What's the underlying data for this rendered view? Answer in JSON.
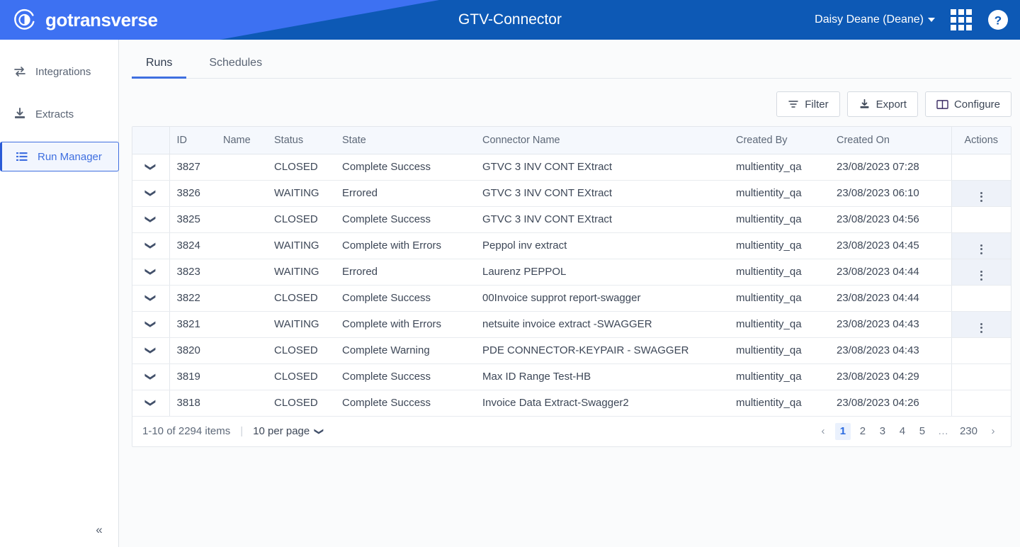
{
  "header": {
    "brand": "gotransverse",
    "logo_icon": "gotransverse-circle-logo",
    "title": "GTV-Connector",
    "user": "Daisy Deane (Deane)",
    "apps_icon": "grid-apps-icon",
    "help_icon": "help-question-icon",
    "colors": {
      "light_blue": "#3d71f2",
      "dark_blue": "#0d59b5"
    }
  },
  "sidebar": {
    "items": [
      {
        "label": "Integrations",
        "icon": "swap-arrows-icon",
        "active": false
      },
      {
        "label": "Extracts",
        "icon": "download-tray-icon",
        "active": false
      },
      {
        "label": "Run Manager",
        "icon": "list-bullets-icon",
        "active": true
      }
    ],
    "collapse_label": "«",
    "collapse_icon": "chevron-double-left-icon"
  },
  "tabs": [
    {
      "label": "Runs",
      "active": true
    },
    {
      "label": "Schedules",
      "active": false
    }
  ],
  "toolbar": {
    "filter_label": "Filter",
    "filter_icon": "filter-lines-icon",
    "export_label": "Export",
    "export_icon": "download-tray-icon",
    "configure_label": "Configure",
    "configure_icon": "columns-layout-icon"
  },
  "table": {
    "columns": [
      "",
      "ID",
      "Name",
      "Status",
      "State",
      "Connector Name",
      "Created By",
      "Created On",
      "Actions"
    ],
    "rows": [
      {
        "id": "3827",
        "name": "",
        "status": "CLOSED",
        "state": "Complete Success",
        "connector": "GTVC 3 INV CONT EXtract",
        "created_by": "multientity_qa",
        "created_on": "23/08/2023 07:28",
        "has_menu": false
      },
      {
        "id": "3826",
        "name": "",
        "status": "WAITING",
        "state": "Errored",
        "connector": "GTVC 3 INV CONT EXtract",
        "created_by": "multientity_qa",
        "created_on": "23/08/2023 06:10",
        "has_menu": true
      },
      {
        "id": "3825",
        "name": "",
        "status": "CLOSED",
        "state": "Complete Success",
        "connector": "GTVC 3 INV CONT EXtract",
        "created_by": "multientity_qa",
        "created_on": "23/08/2023 04:56",
        "has_menu": false
      },
      {
        "id": "3824",
        "name": "",
        "status": "WAITING",
        "state": "Complete with Errors",
        "connector": "Peppol inv extract",
        "created_by": "multientity_qa",
        "created_on": "23/08/2023 04:45",
        "has_menu": true
      },
      {
        "id": "3823",
        "name": "",
        "status": "WAITING",
        "state": "Errored",
        "connector": "Laurenz PEPPOL",
        "created_by": "multientity_qa",
        "created_on": "23/08/2023 04:44",
        "has_menu": true
      },
      {
        "id": "3822",
        "name": "",
        "status": "CLOSED",
        "state": "Complete Success",
        "connector": "00Invoice supprot report-swagger",
        "created_by": "multientity_qa",
        "created_on": "23/08/2023 04:44",
        "has_menu": false
      },
      {
        "id": "3821",
        "name": "",
        "status": "WAITING",
        "state": "Complete with Errors",
        "connector": "netsuite invoice extract -SWAGGER",
        "created_by": "multientity_qa",
        "created_on": "23/08/2023 04:43",
        "has_menu": true
      },
      {
        "id": "3820",
        "name": "",
        "status": "CLOSED",
        "state": "Complete Warning",
        "connector": "PDE CONNECTOR-KEYPAIR - SWAGGER",
        "created_by": "multientity_qa",
        "created_on": "23/08/2023 04:43",
        "has_menu": false
      },
      {
        "id": "3819",
        "name": "",
        "status": "CLOSED",
        "state": "Complete Success",
        "connector": "Max ID Range Test-HB",
        "created_by": "multientity_qa",
        "created_on": "23/08/2023 04:29",
        "has_menu": false
      },
      {
        "id": "3818",
        "name": "",
        "status": "CLOSED",
        "state": "Complete Success",
        "connector": "Invoice Data Extract-Swagger2",
        "created_by": "multientity_qa",
        "created_on": "23/08/2023 04:26",
        "has_menu": false
      }
    ],
    "expand_icon": "chevron-down-icon",
    "row_menu_icon": "kebab-menu-icon"
  },
  "pagination": {
    "items_text": "1-10 of 2294 items",
    "per_page_text": "10 per page",
    "per_page_icon": "chevron-down-icon",
    "prev_label": "‹",
    "next_label": "›",
    "pages": [
      "1",
      "2",
      "3",
      "4",
      "5",
      "…",
      "230"
    ],
    "current_page": "1"
  }
}
